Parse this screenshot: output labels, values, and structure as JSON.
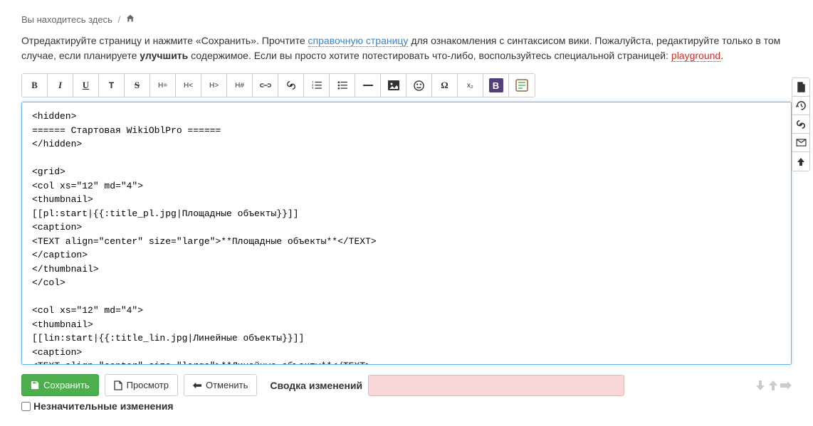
{
  "breadcrumb": {
    "label": "Вы находитесь здесь"
  },
  "intro": {
    "part1": "Отредактируйте страницу и нажмите «Сохранить». Прочтите ",
    "link1": "справочную страницу",
    "part2": " для ознакомления с синтаксисом вики. Пожалуйста, редактируйте только в том случае, если планируете ",
    "strong": "улучшить",
    "part3": " содержимое. Если вы просто хотите потестировать что-либо, воспользуйтесь специальной страницей: ",
    "link2": "playground",
    "part4": "."
  },
  "toolbar": {
    "bold": "B",
    "italic": "I",
    "underline": "U",
    "mono": "T",
    "strike": "S",
    "hsame": "H=",
    "hminus": "H<",
    "hplus": "H>",
    "hhash": "H#",
    "sub": "x₂"
  },
  "editor_content": "<hidden>\n====== Стартовая WikiOblPro ======\n</hidden>\n\n<grid>\n<col xs=\"12\" md=\"4\">\n<thumbnail>\n[[pl:start|{{:title_pl.jpg|Площадные объекты}}]]\n<caption>\n<TEXT align=\"center\" size=\"large\">**Площадные объекты**</TEXT>\n</caption>\n</thumbnail>\n</col>\n\n<col xs=\"12\" md=\"4\">\n<thumbnail>\n[[lin:start|{{:title_lin.jpg|Линейные объекты}}]]\n<caption>\n<TEXT align=\"center\" size=\"large\">**Линейные объекты**</TEXT>\n</caption>\n</thumbnail>",
  "buttons": {
    "save": "Сохранить",
    "preview": "Просмотр",
    "cancel": "Отменить"
  },
  "summary_label": "Сводка изменений",
  "minor_label": "Незначительные изменения"
}
